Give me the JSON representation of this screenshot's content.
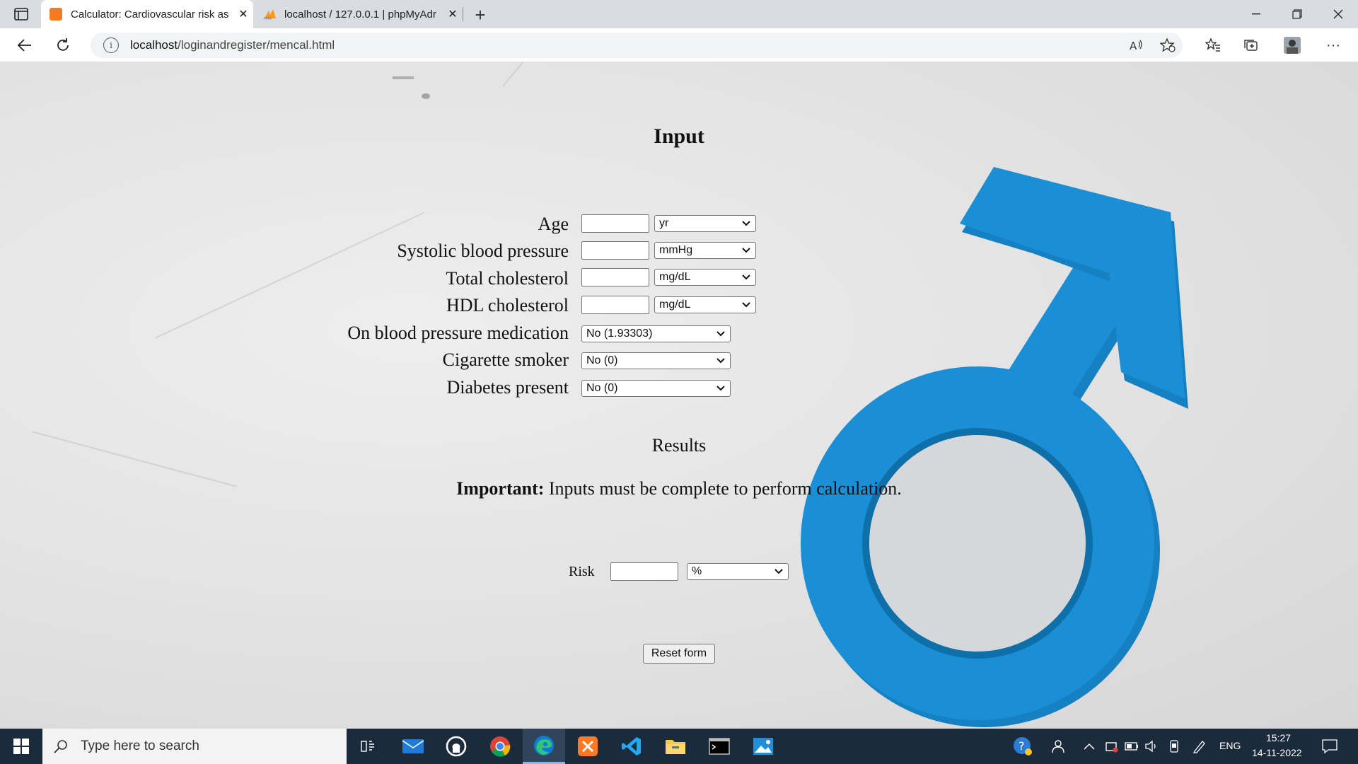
{
  "browser": {
    "tabs": [
      {
        "title": "Calculator: Cardiovascular risk as",
        "active": true,
        "favicon": "xampp-icon"
      },
      {
        "title": "localhost / 127.0.0.1 | phpMyAdr",
        "active": false,
        "favicon": "phpmyadmin-icon"
      }
    ],
    "url_host": "localhost",
    "url_path": "/loginandregister/mencal.html"
  },
  "page": {
    "heading": "Input",
    "fields": [
      {
        "label": "Age",
        "unit": "yr"
      },
      {
        "label": "Systolic blood pressure",
        "unit": "mmHg"
      },
      {
        "label": "Total cholesterol",
        "unit": "mg/dL"
      },
      {
        "label": "HDL cholesterol",
        "unit": "mg/dL"
      }
    ],
    "selects": [
      {
        "label": "On blood pressure medication",
        "value": "No (1.93303)"
      },
      {
        "label": "Cigarette smoker",
        "value": "No (0)"
      },
      {
        "label": "Diabetes present",
        "value": "No (0)"
      }
    ],
    "results_heading": "Results",
    "important_bold": "Important:",
    "important_text": " Inputs must be complete to perform calculation.",
    "risk_label": "Risk",
    "risk_unit": "%",
    "reset_label": "Reset form"
  },
  "taskbar": {
    "search_placeholder": "Type here to search",
    "language": "ENG",
    "time": "15:27",
    "date": "14-11-2022"
  },
  "colors": {
    "accent_blue": "#1a8fd6",
    "taskbar": "#1b2b3c"
  }
}
